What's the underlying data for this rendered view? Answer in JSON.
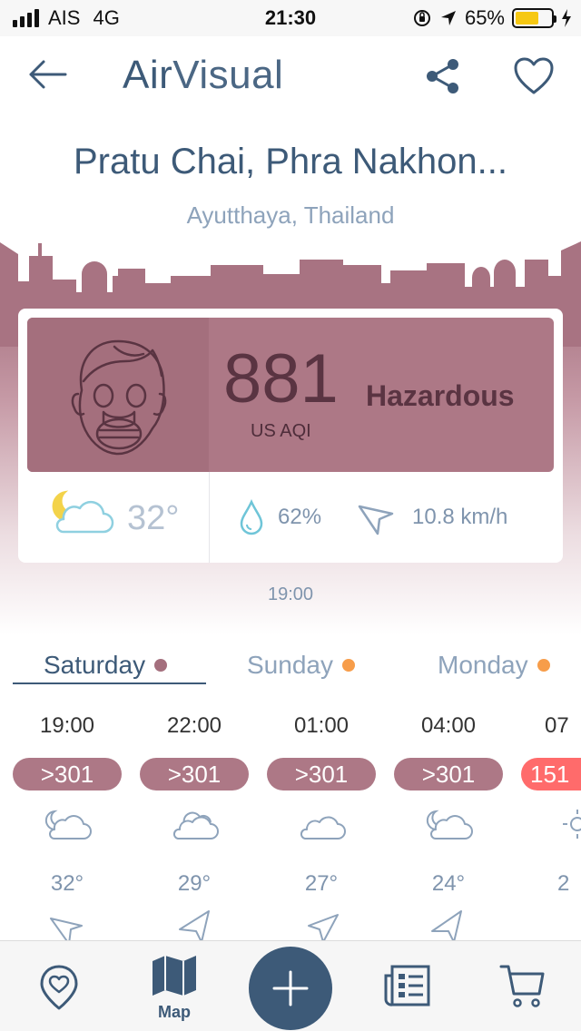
{
  "status_bar": {
    "carrier": "AIS",
    "network": "4G",
    "time": "21:30",
    "battery_percent": "65%",
    "battery_level": 0.65,
    "icons": [
      "signal-icon",
      "orientation-lock-icon",
      "location-arrow-icon",
      "battery-icon",
      "charging-icon"
    ]
  },
  "header": {
    "logo_part1": "Air",
    "logo_part2": "Visual",
    "back_icon": "back-arrow-icon",
    "share_icon": "share-icon",
    "favorite_icon": "heart-icon"
  },
  "location": {
    "city": "Pratu Chai, Phra Nakhon...",
    "region": "Ayutthaya, Thailand"
  },
  "current": {
    "aqi": "881",
    "aqi_unit": "US AQI",
    "level": "Hazardous",
    "temperature": "32°",
    "humidity": "62%",
    "wind_speed": "10.8 km/h",
    "updated": "19:00"
  },
  "colors": {
    "hazardous": "#ad7886",
    "unhealthy": "#ff6b6b",
    "primary": "#3d5a78",
    "dot_hazardous": "#a46f7d",
    "dot_orange": "#f79d4a"
  },
  "days": [
    {
      "label": "Saturday",
      "dot_color": "#a46f7d",
      "active": true
    },
    {
      "label": "Sunday",
      "dot_color": "#f79d4a",
      "active": false
    },
    {
      "label": "Monday",
      "dot_color": "#f79d4a",
      "active": false
    }
  ],
  "forecast": [
    {
      "time": "19:00",
      "aqi": ">301",
      "temp": "32°",
      "weather": "night-partly-cloudy-icon"
    },
    {
      "time": "22:00",
      "aqi": ">301",
      "temp": "29°",
      "weather": "cloudy-icon"
    },
    {
      "time": "01:00",
      "aqi": ">301",
      "temp": "27°",
      "weather": "cloud-icon"
    },
    {
      "time": "04:00",
      "aqi": ">301",
      "temp": "24°",
      "weather": "night-partly-cloudy-icon"
    },
    {
      "time": "07",
      "aqi": "151",
      "temp": "2",
      "weather": "sun-icon"
    }
  ],
  "tabbar": {
    "map_label": "Map",
    "items": [
      "favorites-icon",
      "map-icon",
      "add-icon",
      "news-icon",
      "cart-icon"
    ]
  }
}
